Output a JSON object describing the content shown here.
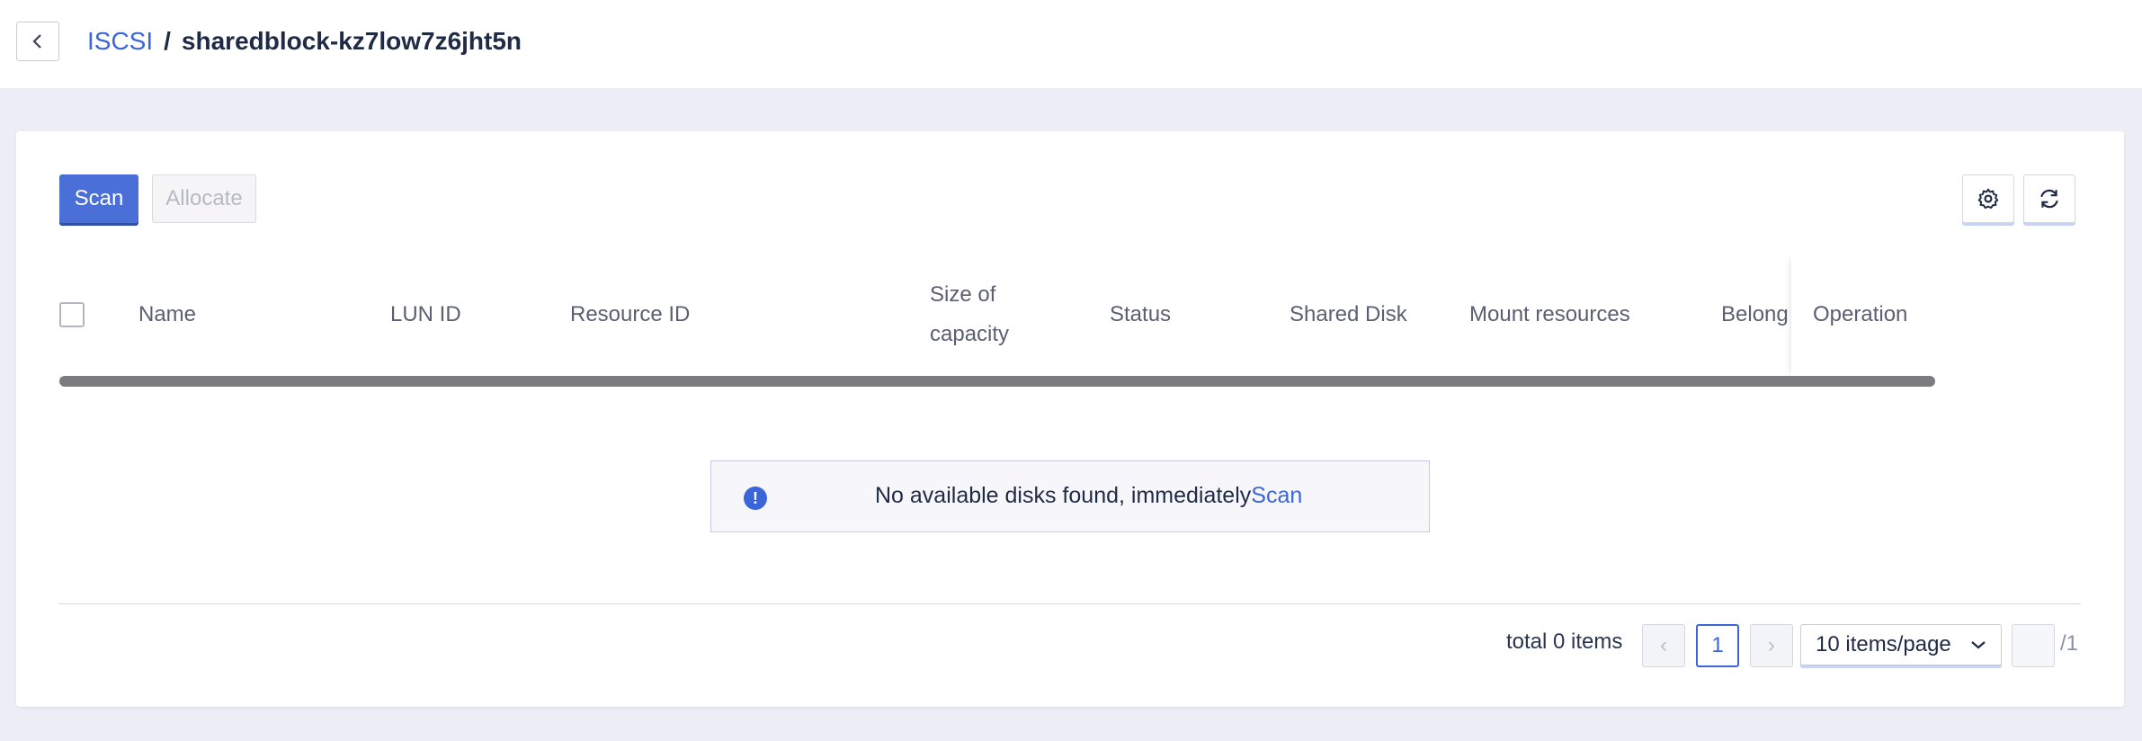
{
  "header": {
    "breadcrumb_link": "ISCSI",
    "separator": "/",
    "current": "sharedblock-kz7low7z6jht5n"
  },
  "toolbar": {
    "scan_label": "Scan",
    "allocate_label": "Allocate"
  },
  "table": {
    "columns": {
      "name": "Name",
      "lun_id": "LUN ID",
      "resource_id": "Resource ID",
      "size_line1": "Size of",
      "size_line2": "capacity",
      "status": "Status",
      "shared_disk": "Shared Disk",
      "mount_resources": "Mount resources",
      "belong": "Belong",
      "operation": "Operation"
    },
    "empty_text": "No available disks found, immediately",
    "empty_link": "Scan"
  },
  "pagination": {
    "total_text": "total 0 items",
    "prev": "‹",
    "current_page": "1",
    "next": "›",
    "per_page": "10 items/page",
    "page_total": "/1"
  }
}
